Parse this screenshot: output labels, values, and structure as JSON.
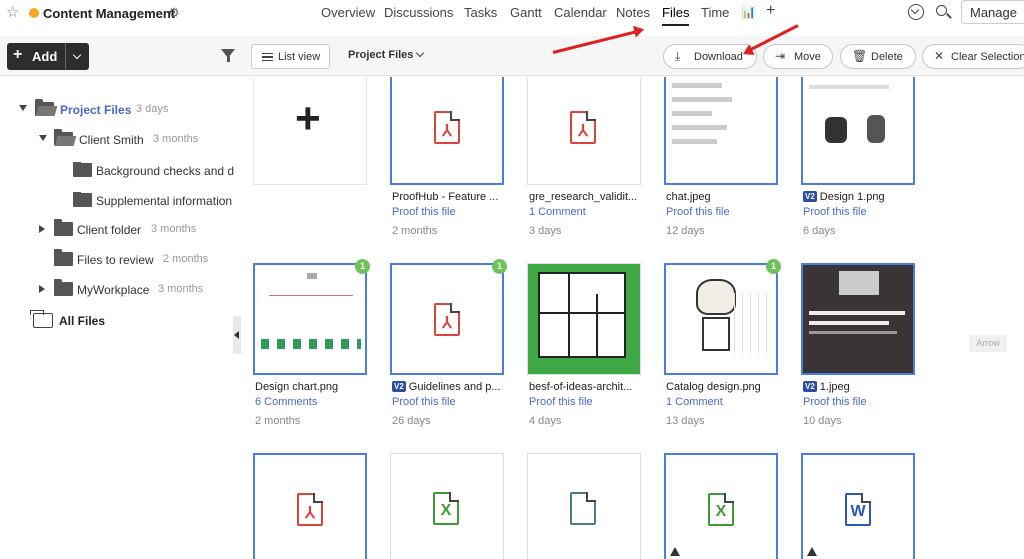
{
  "topbar": {
    "project_title": "Content Management",
    "project_dot_color": "#f5a623",
    "nav": [
      "Overview",
      "Discussions",
      "Tasks",
      "Gantt",
      "Calendar",
      "Notes",
      "Files",
      "Time"
    ],
    "active_nav": "Files",
    "manage_label": "Manage"
  },
  "toolbar": {
    "add_label": "Add",
    "listview_label": "List view",
    "project_files_label": "Project Files",
    "download_label": "Download",
    "move_label": "Move",
    "delete_label": "Delete",
    "clear_label": "Clear Selection"
  },
  "sidebar": {
    "project_files": {
      "label": "Project Files",
      "ago": "3 days"
    },
    "client_smith": {
      "label": "Client Smith",
      "ago": "3 months"
    },
    "background": {
      "label": "Background checks and d"
    },
    "supplemental": {
      "label": "Supplemental information"
    },
    "client_folder": {
      "label": "Client folder",
      "ago": "3 months"
    },
    "files_review": {
      "label": "Files to review",
      "ago": "2 months"
    },
    "myworkplace": {
      "label": "MyWorkplace",
      "ago": "3 months"
    },
    "all_files": {
      "label": "All Files"
    }
  },
  "accent_color": "#4a7de0",
  "files_row1": [
    {
      "name": "ProofHub - Feature ...",
      "proof": "Proof this file",
      "ago": "2 months"
    },
    {
      "name": "gre_research_validit...",
      "proof": "1 Comment",
      "ago": "3 days"
    },
    {
      "name": "chat.jpeg",
      "proof": "Proof this file",
      "ago": "12 days"
    },
    {
      "name": "Design 1.png",
      "version": "V2",
      "proof": "Proof this file",
      "ago": "6 days"
    }
  ],
  "files_row2": [
    {
      "name": "Design chart.png",
      "proof": "6 Comments",
      "ago": "2 months",
      "badge": "1"
    },
    {
      "name": "Guidelines and p...",
      "version": "V2",
      "proof": "Proof this file",
      "ago": "26 days",
      "badge": "1"
    },
    {
      "name": "besf-of-ideas-archit...",
      "proof": "Proof this file",
      "ago": "4 days"
    },
    {
      "name": "Catalog design.png",
      "proof": "1 Comment",
      "ago": "13 days",
      "badge": "1"
    },
    {
      "name": "1.jpeg",
      "version": "V2",
      "proof": "Proof this file",
      "ago": "10 days"
    }
  ],
  "arrow_tag": "Arrow",
  "doc_glyphs": {
    "pdf": "⅄",
    "excel": "X",
    "word": "W"
  }
}
